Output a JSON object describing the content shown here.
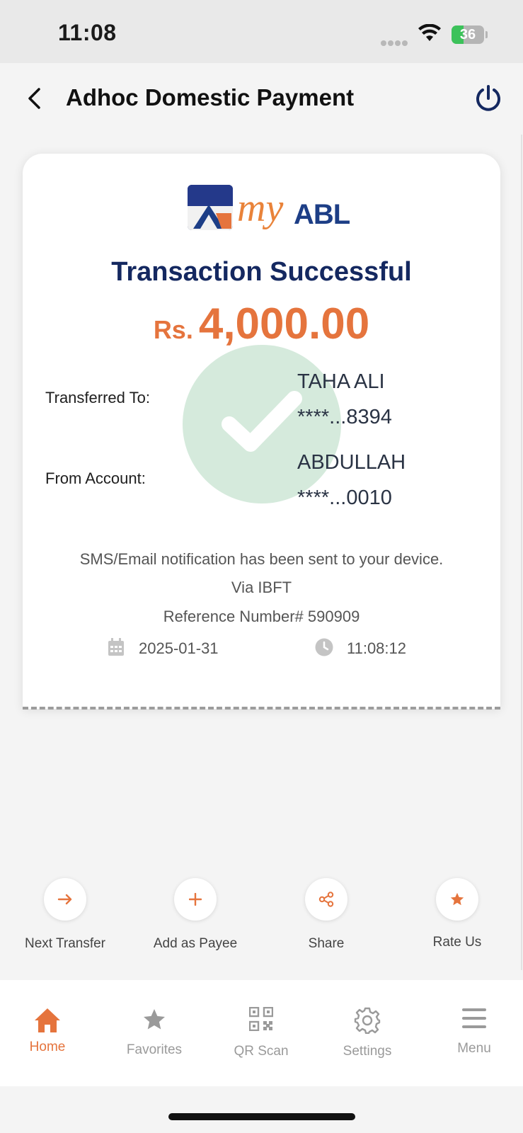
{
  "status_bar": {
    "time": "11:08",
    "battery": "36",
    "battery_level_percent": 36
  },
  "header": {
    "title": "Adhoc Domestic Payment"
  },
  "receipt": {
    "brand_my": "my",
    "brand_abl": "ABL",
    "title": "Transaction Successful",
    "currency": "Rs.",
    "amount": "4,000.00",
    "transferred_to_label": "Transferred To:",
    "transferred_to_name": "TAHA ALI",
    "transferred_to_account": "****...8394",
    "from_account_label": "From Account:",
    "from_account_name": "ABDULLAH",
    "from_account_number": "****...0010",
    "notification": "SMS/Email notification has been sent to your device.",
    "via": "Via IBFT",
    "reference": "Reference Number# 590909",
    "date": "2025-01-31",
    "time": "11:08:12"
  },
  "actions": [
    {
      "label": "Next Transfer",
      "icon": "arrow-right-icon"
    },
    {
      "label": "Add as Payee",
      "icon": "plus-icon"
    },
    {
      "label": "Share",
      "icon": "share-icon"
    },
    {
      "label": "Rate Us",
      "icon": "star-icon"
    }
  ],
  "tabs": [
    {
      "label": "Home",
      "icon": "home-icon",
      "active": true
    },
    {
      "label": "Favorites",
      "icon": "star-icon"
    },
    {
      "label": "QR Scan",
      "icon": "qr-icon"
    },
    {
      "label": "Settings",
      "icon": "gear-icon"
    },
    {
      "label": "Menu",
      "icon": "hamburger-icon"
    }
  ],
  "colors": {
    "accent": "#e5743d",
    "navy": "#142860",
    "success_circle": "#d5eadc"
  }
}
